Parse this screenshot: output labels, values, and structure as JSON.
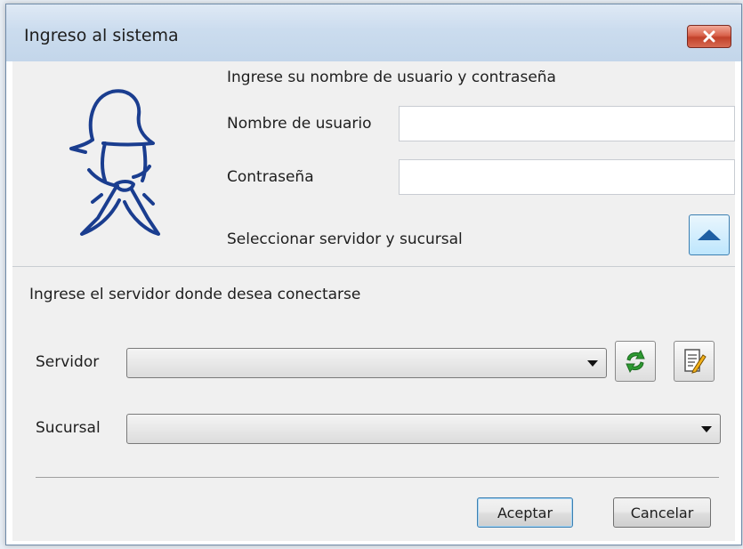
{
  "window": {
    "title": "Ingreso al sistema",
    "close_icon": "close-x-icon"
  },
  "login": {
    "header": "Ingrese su nombre de usuario y contraseña",
    "username_label": "Nombre de usuario",
    "username_value": "",
    "password_label": "Contraseña",
    "password_value": "",
    "toggle_label": "Seleccionar servidor y sucursal",
    "toggle_icon": "chevron-up-icon",
    "logo_icon": "gaucho-hat-logo-icon"
  },
  "server": {
    "header": "Ingrese el servidor donde desea conectarse",
    "server_label": "Servidor",
    "server_value": "",
    "refresh_icon": "refresh-icon",
    "edit_icon": "edit-document-icon",
    "branch_label": "Sucursal",
    "branch_value": ""
  },
  "actions": {
    "accept_label": "Aceptar",
    "cancel_label": "Cancelar"
  },
  "colors": {
    "logo": "#1a3d8f",
    "accent": "#3c7fb1",
    "close": "#c2412a"
  }
}
